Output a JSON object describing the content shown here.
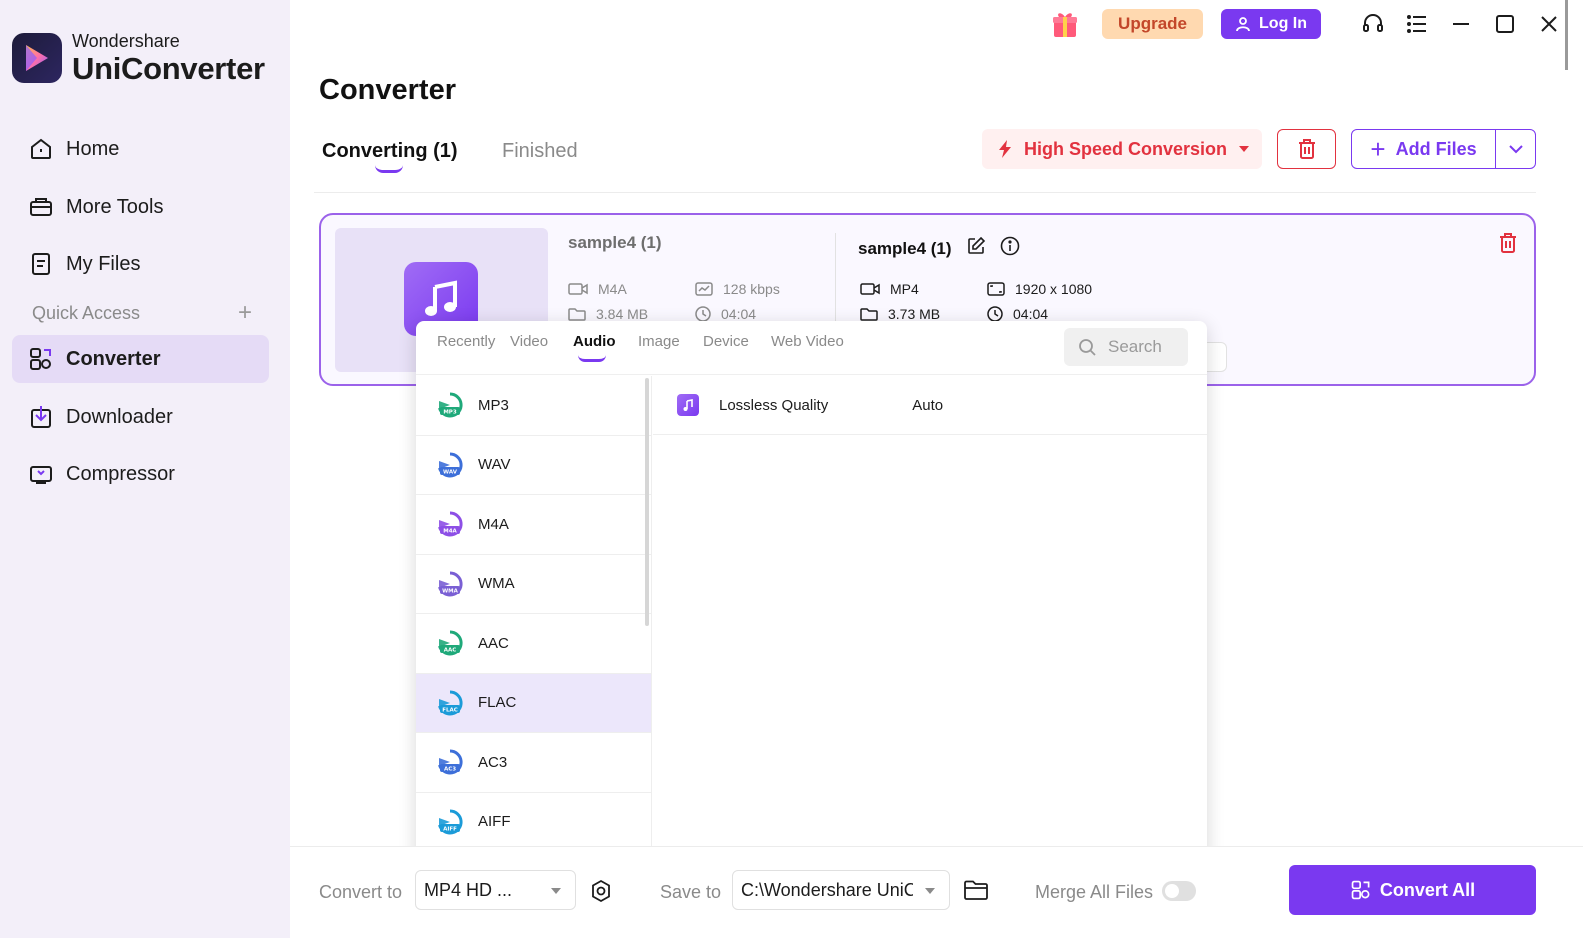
{
  "app": {
    "brand_small": "Wondershare",
    "brand_big": "UniConverter"
  },
  "sidebar": {
    "items": [
      {
        "label": "Home",
        "icon": "home-icon"
      },
      {
        "label": "More Tools",
        "icon": "toolbox-icon"
      },
      {
        "label": "My Files",
        "icon": "file-icon"
      },
      {
        "label": "Converter",
        "icon": "converter-icon",
        "active": true
      },
      {
        "label": "Downloader",
        "icon": "download-icon"
      },
      {
        "label": "Compressor",
        "icon": "compress-icon"
      }
    ],
    "quick_access_label": "Quick Access",
    "quick_access_add": "+"
  },
  "topbar": {
    "upgrade_label": "Upgrade",
    "login_label": "Log In"
  },
  "page": {
    "title": "Converter",
    "tabs": [
      {
        "label": "Converting (1)",
        "active": true
      },
      {
        "label": "Finished",
        "active": false
      }
    ],
    "high_speed_label": "High Speed Conversion",
    "add_files_label": "Add Files"
  },
  "file": {
    "source": {
      "name": "sample4 (1)",
      "format": "M4A",
      "bitrate": "128 kbps",
      "size": "3.84 MB",
      "duration": "04:04"
    },
    "target": {
      "name": "sample4 (1)",
      "format": "MP4",
      "resolution": "1920 x 1080",
      "size": "3.73 MB",
      "duration": "04:04"
    }
  },
  "format_panel": {
    "tabs": [
      "Recently",
      "Video",
      "Audio",
      "Image",
      "Device",
      "Web Video"
    ],
    "active_tab": "Audio",
    "search_placeholder": "Search",
    "formats": [
      {
        "label": "MP3",
        "badge": "MP3",
        "color": "#1fa97a"
      },
      {
        "label": "WAV",
        "badge": "WAV",
        "color": "#3d6fd9"
      },
      {
        "label": "M4A",
        "badge": "M4A",
        "color": "#8d4fe6"
      },
      {
        "label": "WMA",
        "badge": "WMA",
        "color": "#7a5fd4"
      },
      {
        "label": "AAC",
        "badge": "AAC",
        "color": "#1fa97a"
      },
      {
        "label": "FLAC",
        "badge": "FLAC",
        "color": "#1b9bd8",
        "selected": true
      },
      {
        "label": "AC3",
        "badge": "AC3",
        "color": "#3d6fd9"
      },
      {
        "label": "AIFF",
        "badge": "AIFF",
        "color": "#1b9bd8"
      }
    ],
    "quality": {
      "label": "Lossless Quality",
      "value": "Auto"
    }
  },
  "bottombar": {
    "convert_to_label": "Convert to",
    "convert_to_value": "MP4 HD ...",
    "save_to_label": "Save to",
    "save_to_value": "C:\\Wondershare UniCo",
    "merge_label": "Merge All Files",
    "merge_enabled": false,
    "convert_all_label": "Convert All"
  },
  "colors": {
    "accent": "#7a39f0",
    "danger": "#e2323f",
    "sidebar_bg": "#f3eff9",
    "active_nav": "#e5dbf6"
  }
}
